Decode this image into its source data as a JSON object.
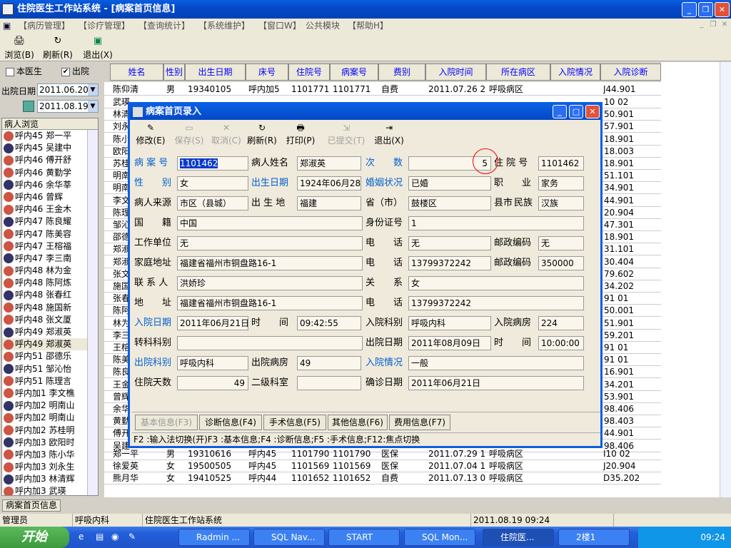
{
  "window": {
    "title": "住院医生工作站系统 - [病案首页信息]"
  },
  "menu": [
    "【病历管理】",
    "【诊疗管理】",
    "【查询统计】",
    "【系统维护】",
    "【窗口W】",
    "公共模块",
    "【帮助H】"
  ],
  "toolbar": [
    "浏览(B)",
    "刷新(R)",
    "退出(X)"
  ],
  "left": {
    "chk1": "本医生",
    "chk2": "出院",
    "date_label": "出院日期",
    "date1": "2011.06.20",
    "date2": "2011.08.19",
    "list_header": "病人浏览",
    "patients": [
      "呼内45 郑一平",
      "呼内45 吴建中",
      "呼内46 傅开舒",
      "呼内46 黄勤学",
      "呼内46 余华莘",
      "呼内46 曾辉",
      "呼内46 王金木",
      "呼内47 陈良耀",
      "呼内47 陈美容",
      "呼内47 王榕福",
      "呼内47 李三南",
      "呼内48 林为金",
      "呼内48 陈阿炼",
      "呼内48 张春红",
      "呼内48 施国新",
      "呼内48 张文厦",
      "呼内49 郑淑英",
      "呼内49 郑淑英",
      "呼内51 邵德乐",
      "呼内51 邹沁怡",
      "呼内51 陈理言",
      "呼内加1 李文樵",
      "呼内加2 明南山",
      "呼内加2 明南山",
      "呼内加2 苏桂明",
      "呼内加3 欧阳时",
      "呼内加3 陈小华",
      "呼内加3 刘永生",
      "呼内加3 林清辉",
      "呼内加3 武瑛"
    ]
  },
  "grid": {
    "headers": [
      "姓名",
      "性别",
      "出生日期",
      "床号",
      "住院号",
      "病案号",
      "费别",
      "入院时间",
      "所在病区",
      "入院情况",
      "入院诊断"
    ],
    "top_row": [
      "陈仰清",
      "男",
      "19340105",
      "呼内加5",
      "1101771",
      "1101771",
      "自费",
      "2011.07.26 21",
      "呼吸病区",
      "",
      "J44.901"
    ],
    "left_fragments": [
      "武瑛",
      "林清",
      "刘永",
      "陈小",
      "欧阳",
      "苏桂",
      "明南",
      "明南",
      "李文",
      "陈理",
      "邹沁",
      "邵德",
      "郑淑",
      "郑淑",
      "张文",
      "施国",
      "张春",
      "陈阿",
      "林为",
      "李三",
      "王榕",
      "陈美",
      "陈良",
      "王金",
      "曾辉",
      "余华",
      "黄勤",
      "傅开",
      "吴建"
    ],
    "right_fragments": [
      "10 02",
      "50.901",
      "57.901",
      "18.901",
      "18.003",
      "18.901",
      "51.101",
      "34.901",
      "44.901",
      "20.904",
      "47.301",
      "18.901",
      "31.101",
      "30.404",
      "79.602",
      "34.202",
      "91 01",
      "50.001",
      "51.901",
      "59.201",
      "91 01",
      "91 01",
      "16.901",
      "34.201",
      "53.901",
      "98.406",
      "98.403",
      "44.901",
      "98.406"
    ],
    "bottom_rows": [
      [
        "郑一平",
        "男",
        "19310616",
        "呼内45",
        "1101790",
        "1101790",
        "医保",
        "2011.07.29 18",
        "呼吸病区",
        "",
        "I10 02"
      ],
      [
        "徐爱英",
        "女",
        "19500505",
        "呼内45",
        "1101569",
        "1101569",
        "医保",
        "2011.07.04 10",
        "呼吸病区",
        "",
        "J20.904"
      ],
      [
        "熊月华",
        "女",
        "19410525",
        "呼内44",
        "1101652",
        "1101652",
        "自费",
        "2011.07.13 09",
        "呼吸病区",
        "",
        "D35.202"
      ]
    ]
  },
  "dialog": {
    "title": "病案首页录入",
    "toolbar": [
      "修改(E)",
      "保存(S)",
      "取消(C)",
      "刷新(R)",
      "打印(P)",
      "已提交(T)",
      "退出(X)"
    ],
    "fields": {
      "l_bah": "病 案 号",
      "v_bah": "1101462",
      "l_name": "病人姓名",
      "v_name": "郑淑英",
      "l_cs": "次　　数",
      "v_cs": "5",
      "l_zyh": "住 院 号",
      "v_zyh": "1101462",
      "l_sex": "性　　别",
      "v_sex": "女",
      "l_birth": "出生日期",
      "v_birth": "1924年06月28日",
      "l_marry": "婚姻状况",
      "v_marry": "已婚",
      "l_job": "职　　业",
      "v_job": "家务",
      "l_src": "病人来源",
      "v_src": "市区（县城）",
      "l_bplace": "出 生 地",
      "v_bplace": "福建",
      "l_prov": "省（市）",
      "v_prov": "鼓楼区",
      "l_county": "县市",
      "l_nation": "民族",
      "v_nation": "汉族",
      "l_country": "国　　籍",
      "v_country": "中国",
      "l_id": "身份证号",
      "v_id": "1",
      "l_work": "工作单位",
      "v_work": "无",
      "l_tel1": "电　　话",
      "v_tel1": "无",
      "l_zip1": "邮政编码",
      "v_zip1": "无",
      "l_home": "家庭地址",
      "v_home": "福建省福州市铜盘路16-1",
      "l_tel2": "电　　话",
      "v_tel2": "13799372242",
      "l_zip2": "邮政编码",
      "v_zip2": "350000",
      "l_contact": "联 系 人",
      "v_contact": "洪娇珍",
      "l_rel": "关　　系",
      "v_rel": "女",
      "l_addr": "地　　址",
      "v_addr": "福建省福州市铜盘路16-1",
      "l_tel3": "电　　话",
      "v_tel3": "13799372242",
      "l_indate": "入院日期",
      "v_indate": "2011年06月21日",
      "l_time1": "时　　间",
      "v_time1": "09:42:55",
      "l_indept": "入院科别",
      "v_indept": "呼吸内科",
      "l_inroom": "入院病房",
      "v_inroom": "224",
      "l_trans": "转科科别",
      "v_trans": "",
      "l_outdate": "出院日期",
      "v_outdate": "2011年08月09日",
      "l_time2": "时　　间",
      "v_time2": "10:00:00",
      "l_outdept": "出院科别",
      "v_outdept": "呼吸内科",
      "l_outroom": "出院病房",
      "v_outroom": "49",
      "l_incond": "入院情况",
      "v_incond": "一般",
      "l_days": "住院天数",
      "v_days": "49",
      "l_sub": "二级科室",
      "v_sub": "",
      "l_diagdate": "确诊日期",
      "v_diagdate": "2011年06月21日"
    },
    "tabs": [
      "基本信息(F3)",
      "诊断信息(F4)",
      "手术信息(F5)",
      "其他信息(F6)",
      "费用信息(F7)"
    ],
    "status": "F2 :输入法切换(开)F3 :基本信息;F4 :诊断信息;F5 :手术信息;F12:焦点切换"
  },
  "bottom_tab": "病案首页信息",
  "statusbar": [
    "管理员",
    "呼吸内科",
    "住院医生工作站系统",
    "2011.08.19 09:24"
  ],
  "taskbar": {
    "start": "开始",
    "tasks": [
      "Radmin ...",
      "SQL Nav...",
      "START",
      "SQL Mon...",
      "住院医...",
      "2楼1"
    ],
    "clock": "09:24"
  }
}
